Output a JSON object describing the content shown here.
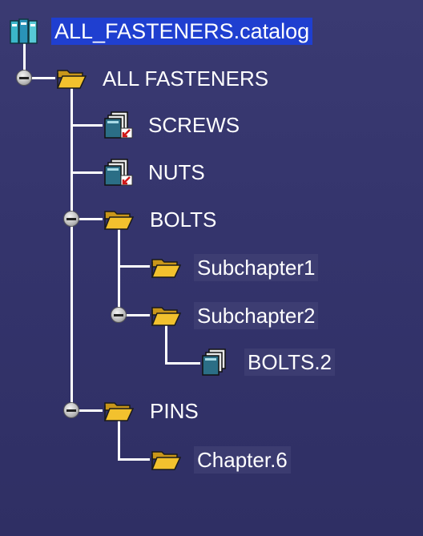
{
  "tree": {
    "root": {
      "label": "ALL_FASTENERS.catalog",
      "icon": "catalog-books-icon",
      "selected": true
    },
    "nodes": [
      {
        "label": "ALL FASTENERS",
        "icon": "folder-open-icon"
      },
      {
        "label": "SCREWS",
        "icon": "document-stack-link-icon"
      },
      {
        "label": "NUTS",
        "icon": "document-stack-link-icon"
      },
      {
        "label": "BOLTS",
        "icon": "folder-open-icon"
      },
      {
        "label": "Subchapter1",
        "icon": "folder-open-icon"
      },
      {
        "label": "Subchapter2",
        "icon": "folder-open-icon"
      },
      {
        "label": "BOLTS.2",
        "icon": "document-stack-icon"
      },
      {
        "label": "PINS",
        "icon": "folder-open-icon"
      },
      {
        "label": "Chapter.6",
        "icon": "folder-open-icon"
      }
    ]
  },
  "colors": {
    "background": "#34346c",
    "lines": "#ffffff",
    "selection": "#1f3fd0",
    "folder": "#f2c12e"
  }
}
